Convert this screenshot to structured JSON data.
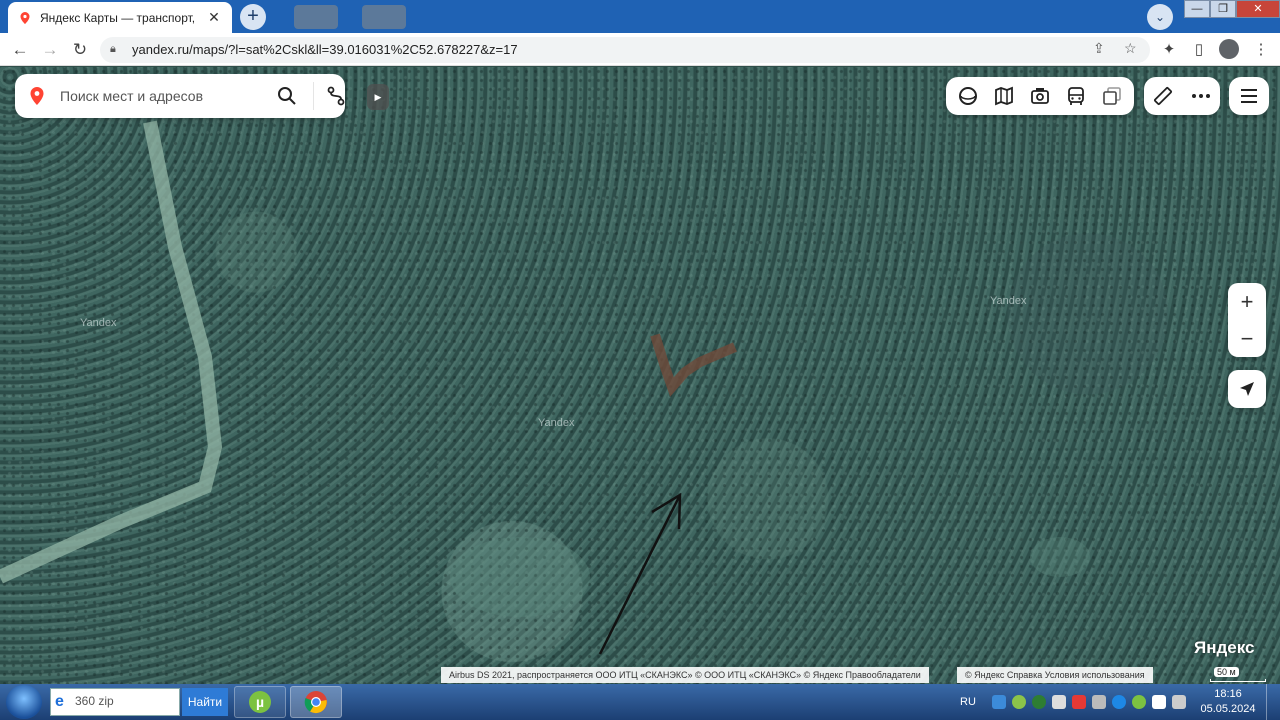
{
  "browser": {
    "tab_title": "Яндекс Карты — транспорт, нав",
    "tab_close": "✕",
    "new_tab": "+",
    "url": "yandex.ru/maps/?l=sat%2Cskl&ll=39.016031%2C52.678227&z=17",
    "window_controls": [
      "—",
      "❐",
      "✕"
    ]
  },
  "map": {
    "search_placeholder": "Поиск мест и адресов",
    "watermarks": [
      "Yandex",
      "Yandex",
      "Yandex"
    ],
    "zoom_in": "+",
    "zoom_out": "−",
    "logo": "Яндекс",
    "attribution": "Airbus DS 2021, распространяется ООО ИТЦ «СКАНЭКС» © ООО ИТЦ «СКАНЭКС» © Яндекс   Правообладатели",
    "footer_links": "© Яндекс   Справка   Условия использования",
    "scale": "50 м",
    "collapse": "▶",
    "icons": {
      "layers": [
        "panorama-icon",
        "map-layers-icon",
        "photo-icon",
        "transport-icon",
        "layers-stack-icon"
      ],
      "tools": [
        "ruler-icon",
        "more-icon"
      ],
      "menu": "hamburger-menu-icon"
    }
  },
  "taskbar": {
    "search_value": "360 zip",
    "go_button": "Найти",
    "language": "RU",
    "time": "18:16",
    "date": "05.05.2024"
  }
}
